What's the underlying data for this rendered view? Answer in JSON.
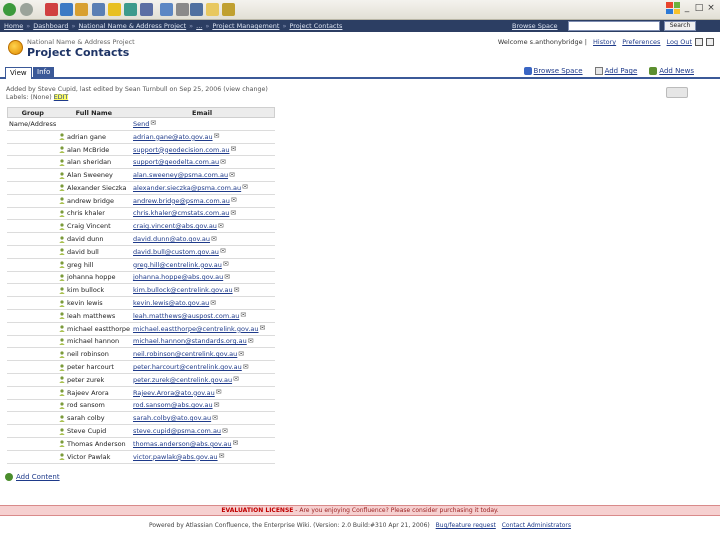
{
  "window": {
    "toolbar_icons": [
      "back-icon",
      "forward-icon",
      "stop-icon",
      "refresh-icon",
      "home-icon",
      "search-icon",
      "favorites-icon",
      "media-icon",
      "history-icon",
      "mail-icon",
      "print-icon",
      "edit-icon",
      "discuss-icon",
      "messenger-icon"
    ],
    "controls": [
      "_",
      "□",
      "×"
    ]
  },
  "topnav": {
    "crumbs": [
      "Home",
      "Dashboard",
      "National Name & Address Project",
      "...",
      "Project Management",
      "Project Contacts"
    ],
    "browse_space": "Browse Space",
    "search_button": "Search"
  },
  "header": {
    "space_name": "National Name & Address Project",
    "page_title": "Project Contacts",
    "welcome": "Welcome s.anthonybridge |",
    "history": "History",
    "preferences": "Preferences",
    "logout": "Log Out"
  },
  "tabs": {
    "view": "View",
    "info": "Info"
  },
  "actions": {
    "browse_space": "Browse Space",
    "add_page": "Add Page",
    "add_news": "Add News"
  },
  "meta": {
    "line": "Added by Steve Cupid, last edited by Sean Turnbull on Sep 25, 2006 (view change)",
    "labels_prefix": "Labels: (None)",
    "edit": "EDIT"
  },
  "table": {
    "headers": {
      "group": "Group",
      "name": "Full Name",
      "email": "Email"
    },
    "group_label": "Name/Address",
    "send_label": "Send",
    "rows": [
      {
        "name": "adrian gane",
        "email": "adrian.gane@ato.gov.au"
      },
      {
        "name": "alan McBride",
        "email": "support@geodecision.com.au"
      },
      {
        "name": "alan sheridan",
        "email": "support@geodelta.com.au"
      },
      {
        "name": "Alan Sweeney",
        "email": "alan.sweeney@psma.com.au"
      },
      {
        "name": "Alexander Sieczka",
        "email": "alexander.sieczka@psma.com.au"
      },
      {
        "name": "andrew bridge",
        "email": "andrew.bridge@psma.com.au"
      },
      {
        "name": "chris khaler",
        "email": "chris.khaler@cmstats.com.au"
      },
      {
        "name": "Craig Vincent",
        "email": "craig.vincent@abs.gov.au"
      },
      {
        "name": "david dunn",
        "email": "david.dunn@ato.gov.au"
      },
      {
        "name": "david bull",
        "email": "david.bull@custom.gov.au"
      },
      {
        "name": "greg hill",
        "email": "greg.hill@centrelink.gov.au"
      },
      {
        "name": "johanna hoppe",
        "email": "johanna.hoppe@abs.gov.au"
      },
      {
        "name": "kim bullock",
        "email": "kim.bullock@centrelink.gov.au"
      },
      {
        "name": "kevin lewis",
        "email": "kevin.lewis@ato.gov.au"
      },
      {
        "name": "leah matthews",
        "email": "leah.matthews@auspost.com.au"
      },
      {
        "name": "michael eastthorpe",
        "email": "michael.eastthorpe@centrelink.gov.au"
      },
      {
        "name": "michael hannon",
        "email": "michael.hannon@standards.org.au"
      },
      {
        "name": "neil robinson",
        "email": "neil.robinson@centrelink.gov.au"
      },
      {
        "name": "peter harcourt",
        "email": "peter.harcourt@centrelink.gov.au"
      },
      {
        "name": "peter zurek",
        "email": "peter.zurek@centrelink.gov.au"
      },
      {
        "name": "Rajeev Arora",
        "email": "Rajeev.Arora@ato.gov.au"
      },
      {
        "name": "rod sansom",
        "email": "rod.sansom@abs.gov.au"
      },
      {
        "name": "sarah colby",
        "email": "sarah.colby@ato.gov.au"
      },
      {
        "name": "Steve Cupid",
        "email": "steve.cupid@psma.com.au"
      },
      {
        "name": "Thomas Anderson",
        "email": "thomas.anderson@abs.gov.au"
      },
      {
        "name": "Victor Pawlak",
        "email": "victor.pawlak@abs.gov.au"
      }
    ]
  },
  "add_content": "Add Content",
  "eval": {
    "bold": "EVALUATION LICENSE",
    "text": " - Are you enjoying Confluence? Please consider purchasing it today."
  },
  "footer": {
    "text": "Powered by Atlassian Confluence, the Enterprise Wiki. (Version: 2.0 Build:#310 Apr 21, 2006)",
    "bug": "Bug/feature request",
    "contact": "Contact Administrators"
  },
  "colors": {
    "nav": "#2c3e63",
    "tab": "#3b5998",
    "link": "#1e3a8a",
    "eval_bg": "#f6d0d0"
  }
}
